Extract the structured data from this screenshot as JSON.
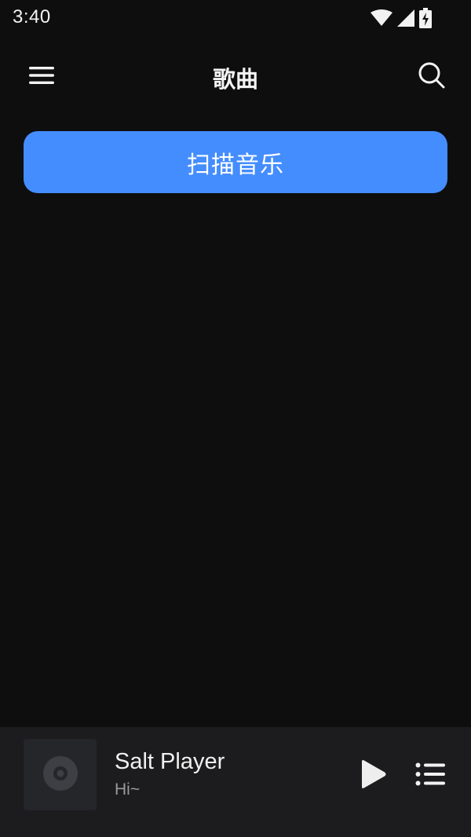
{
  "status_bar": {
    "time": "3:40",
    "icons": [
      "wifi-icon",
      "cellular-signal-icon",
      "battery-charging-icon"
    ]
  },
  "app_bar": {
    "title": "歌曲",
    "left_icon": "hamburger-menu-icon",
    "right_icon": "search-icon"
  },
  "main": {
    "scan_button_label": "扫描音乐"
  },
  "mini_player": {
    "track_title": "Salt Player",
    "track_subtitle": "Hi~",
    "art_icon": "vinyl-disc-icon",
    "play_icon": "play-icon",
    "queue_icon": "playlist-queue-icon"
  },
  "colors": {
    "background": "#0e0e0f",
    "accent": "#448dfe",
    "mini_player_bg": "#1c1c1e",
    "album_art_bg": "#25262a",
    "subtitle_text": "#9a9a9a"
  }
}
